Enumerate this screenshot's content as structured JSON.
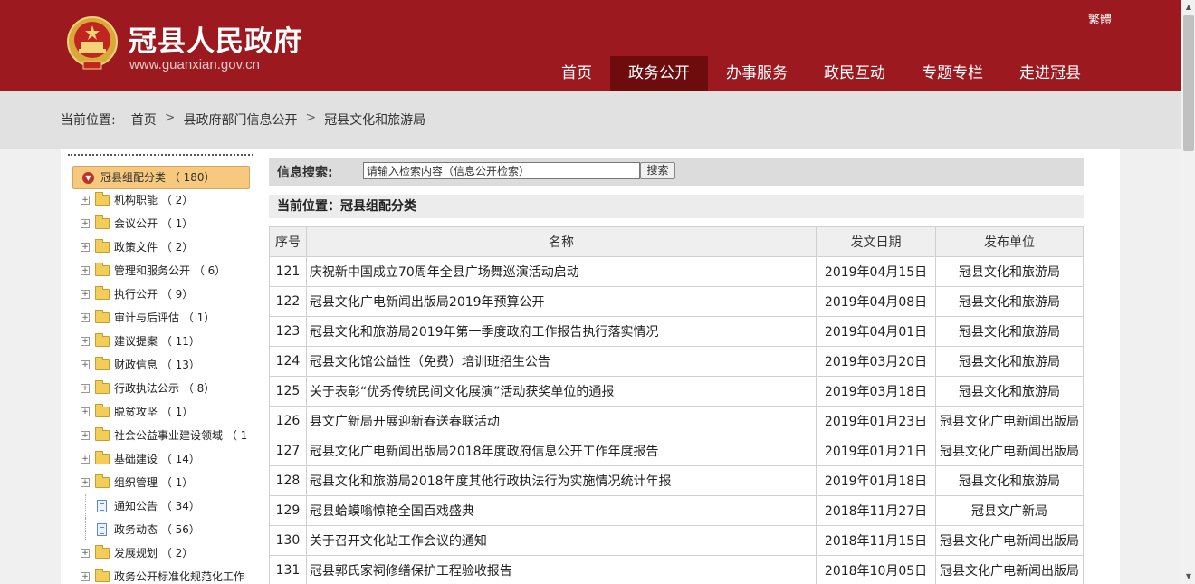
{
  "header": {
    "title": "冠县人民政府",
    "url": "www.guanxian.gov.cn",
    "traditional_link": "繁體",
    "nav": [
      "首页",
      "政务公开",
      "办事服务",
      "政民互动",
      "专题专栏",
      "走进冠县"
    ],
    "active_nav_index": 1
  },
  "breadcrumb": {
    "label": "当前位置:",
    "items": [
      "首页",
      "县政府部门信息公开",
      "冠县文化和旅游局"
    ],
    "separator": ">"
  },
  "sidebar": {
    "root": "冠县组配分类 （ 180）",
    "items": [
      {
        "label": "机构职能 （ 2）",
        "icon": "folder-icon"
      },
      {
        "label": "会议公开 （ 1）",
        "icon": "folder-icon"
      },
      {
        "label": "政策文件 （ 2）",
        "icon": "folder-icon"
      },
      {
        "label": "管理和服务公开 （ 6）",
        "icon": "folder-icon"
      },
      {
        "label": "执行公开 （ 9）",
        "icon": "folder-icon"
      },
      {
        "label": "审计与后评估 （ 1）",
        "icon": "folder-icon"
      },
      {
        "label": "建议提案 （ 11）",
        "icon": "folder-icon"
      },
      {
        "label": "财政信息 （ 13）",
        "icon": "folder-icon"
      },
      {
        "label": "行政执法公示 （ 8）",
        "icon": "folder-icon"
      },
      {
        "label": "脱贫攻坚 （ 1）",
        "icon": "folder-icon"
      },
      {
        "label": "社会公益事业建设领域 （ 1",
        "icon": "folder-icon"
      },
      {
        "label": "基础建设 （ 14）",
        "icon": "folder-icon"
      },
      {
        "label": "组织管理 （ 1）",
        "icon": "folder-icon"
      },
      {
        "label": "通知公告 （ 34）",
        "icon": "document-icon"
      },
      {
        "label": "政务动态 （ 56）",
        "icon": "document-icon"
      },
      {
        "label": "发展规划 （ 2）",
        "icon": "folder-icon"
      },
      {
        "label": "政务公开标准化规范化工作",
        "icon": "folder-icon"
      }
    ]
  },
  "search": {
    "label": "信息搜索:",
    "placeholder": "请输入检索内容（信息公开检索）",
    "button": "搜索"
  },
  "current_position": "当前位置：冠县组配分类",
  "table": {
    "headers": [
      "序号",
      "名称",
      "发文日期",
      "发布单位"
    ],
    "rows": [
      {
        "num": "121",
        "name": "庆祝新中国成立70周年全县广场舞巡演活动启动",
        "date": "2019年04月15日",
        "unit": "冠县文化和旅游局"
      },
      {
        "num": "122",
        "name": "冠县文化广电新闻出版局2019年预算公开",
        "date": "2019年04月08日",
        "unit": "冠县文化和旅游局"
      },
      {
        "num": "123",
        "name": "冠县文化和旅游局2019年第一季度政府工作报告执行落实情况",
        "date": "2019年04月01日",
        "unit": "冠县文化和旅游局"
      },
      {
        "num": "124",
        "name": "冠县文化馆公益性（免费）培训班招生公告",
        "date": "2019年03月20日",
        "unit": "冠县文化和旅游局"
      },
      {
        "num": "125",
        "name": "关于表彰“优秀传统民间文化展演”活动获奖单位的通报",
        "date": "2019年03月18日",
        "unit": "冠县文化和旅游局"
      },
      {
        "num": "126",
        "name": "县文广新局开展迎新春送春联活动",
        "date": "2019年01月23日",
        "unit": "冠县文化广电新闻出版局"
      },
      {
        "num": "127",
        "name": "冠县文化广电新闻出版局2018年度政府信息公开工作年度报告",
        "date": "2019年01月21日",
        "unit": "冠县文化广电新闻出版局"
      },
      {
        "num": "128",
        "name": "冠县文化和旅游局2018年度其他行政执法行为实施情况统计年报",
        "date": "2019年01月18日",
        "unit": "冠县文化和旅游局"
      },
      {
        "num": "129",
        "name": "冠县蛤蟆嗡惊艳全国百戏盛典",
        "date": "2018年11月27日",
        "unit": "冠县文广新局"
      },
      {
        "num": "130",
        "name": "关于召开文化站工作会议的通知",
        "date": "2018年11月15日",
        "unit": "冠县文化广电新闻出版局"
      },
      {
        "num": "131",
        "name": "冠县郭氏家祠修缮保护工程验收报告",
        "date": "2018年10月05日",
        "unit": "冠县文化广电新闻出版局"
      }
    ]
  },
  "colors": {
    "header_bg": "#9c1a1f",
    "nav_active_bg": "#6e0b0d",
    "sidebar_root_bg": "#f7c97e"
  }
}
